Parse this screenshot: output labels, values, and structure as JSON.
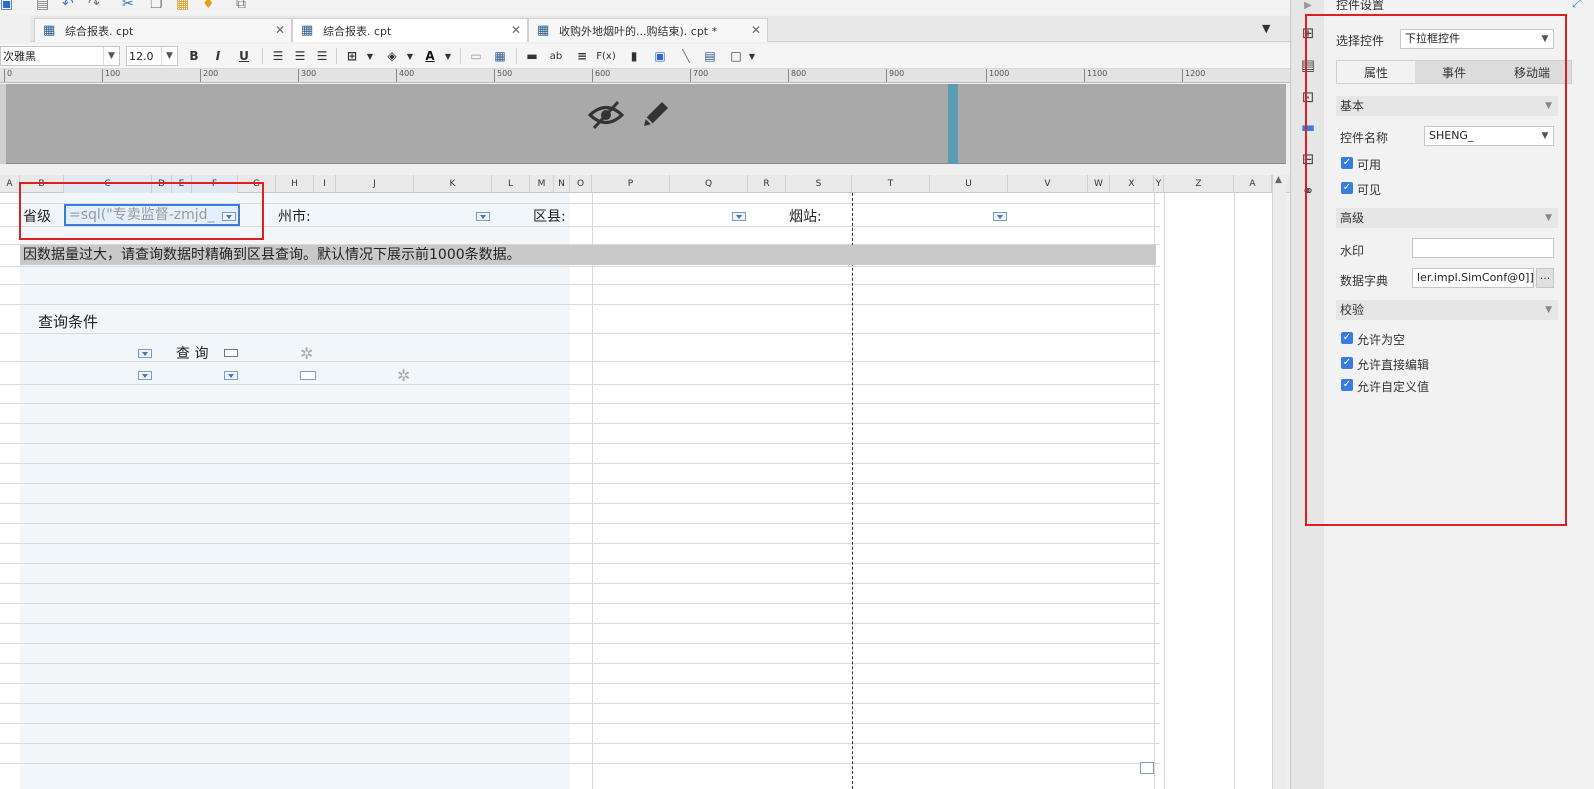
{
  "tabs": [
    {
      "label": "综合报表. cpt",
      "active": false
    },
    {
      "label": "综合报表. cpt",
      "active": true
    },
    {
      "label": "收购外地烟叶的...购结束). cpt *",
      "active": false
    }
  ],
  "toolbar": {
    "font_name": "次雅黑",
    "font_size": "12.0",
    "bold": "B",
    "italic": "I",
    "underline": "U",
    "text_tool": "ab",
    "formula_tool": "F(x)"
  },
  "ruler": [
    "0",
    "100",
    "200",
    "300",
    "400",
    "500",
    "600",
    "700",
    "800",
    "900",
    "1000",
    "1100",
    "1200"
  ],
  "columns": [
    "A",
    "B",
    "C",
    "D",
    "E",
    "F",
    "G",
    "H",
    "I",
    "J",
    "K",
    "L",
    "M",
    "N",
    "O",
    "P",
    "Q",
    "R",
    "S",
    "T",
    "U",
    "V",
    "W",
    "X",
    "Y",
    "Z",
    "A"
  ],
  "sheet": {
    "province_label": "省级",
    "province_value": "=sql(\"专卖监督-zmjd_",
    "city_label": "州市:",
    "county_label": "区县:",
    "station_label": "烟站:",
    "notice": "因数据量过大，请查询数据时精确到区县查询。默认情况下展示前1000条数据。",
    "query_title": "查询条件",
    "query_button": "查 询"
  },
  "panel": {
    "title": "控件设置",
    "select_label": "选择控件",
    "select_value": "下拉框控件",
    "tabs": [
      "属性",
      "事件",
      "移动端"
    ],
    "sections": {
      "basic": "基本",
      "advanced": "高级",
      "validation": "校验"
    },
    "name_label": "控件名称",
    "name_value": "SHENG_",
    "enabled_label": "可用",
    "visible_label": "可见",
    "watermark_label": "水印",
    "watermark_value": "",
    "dict_label": "数据字典",
    "dict_value": "ler.impl.SimConf@0]]",
    "allow_empty_label": "允许为空",
    "allow_edit_label": "允许直接编辑",
    "allow_custom_label": "允许自定义值",
    "dots": "···"
  },
  "colors": {
    "accent": "#3a7be0",
    "highlight_red": "#e02020",
    "header_band": "#a9a9a9",
    "grid_blue": "#f1f6fb"
  }
}
